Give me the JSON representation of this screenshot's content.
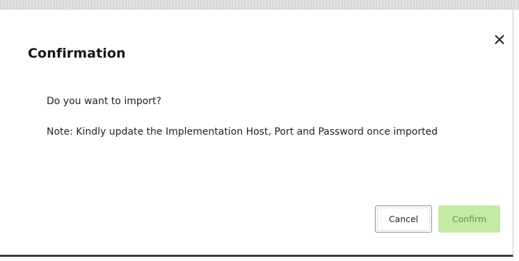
{
  "dialog": {
    "title": "Confirmation",
    "close_icon": "close-icon",
    "message": "Do you want to import?",
    "note": "Note: Kindly update the Implementation Host, Port and Password once imported",
    "buttons": {
      "cancel_label": "Cancel",
      "confirm_label": "Confirm"
    },
    "colors": {
      "confirm_background": "#c4eaa6",
      "confirm_text": "#5a9a3a",
      "title_text": "#161616"
    }
  }
}
